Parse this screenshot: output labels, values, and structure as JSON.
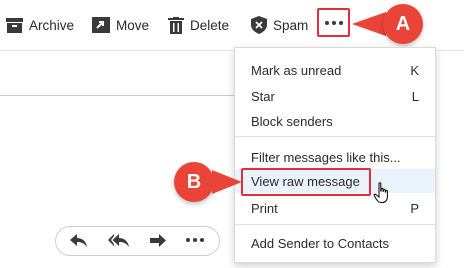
{
  "toolbar": {
    "archive_label": "Archive",
    "move_label": "Move",
    "delete_label": "Delete",
    "spam_label": "Spam",
    "icons": [
      "archive-icon",
      "move-icon",
      "trash-icon",
      "shield-icon",
      "more-icon"
    ]
  },
  "menu": {
    "items": [
      {
        "label": "Mark as unread",
        "shortcut": "K"
      },
      {
        "label": "Star",
        "shortcut": "L"
      },
      {
        "label": "Block senders",
        "shortcut": ""
      },
      {
        "label": "Filter messages like this...",
        "shortcut": ""
      },
      {
        "label": "View raw message",
        "shortcut": ""
      },
      {
        "label": "Print",
        "shortcut": "P"
      },
      {
        "label": "Add Sender to Contacts",
        "shortcut": ""
      }
    ],
    "highlighted_item": "View raw message"
  },
  "callouts": {
    "a": "A",
    "b": "B"
  },
  "reply_bar": {
    "icons": [
      "reply-icon",
      "reply-all-icon",
      "forward-icon",
      "more-icon"
    ]
  },
  "colors": {
    "callout": "#ea4338",
    "highlight_border": "#e0313a",
    "hover_bg": "#eaf2fb",
    "text": "#2b2b2b"
  }
}
